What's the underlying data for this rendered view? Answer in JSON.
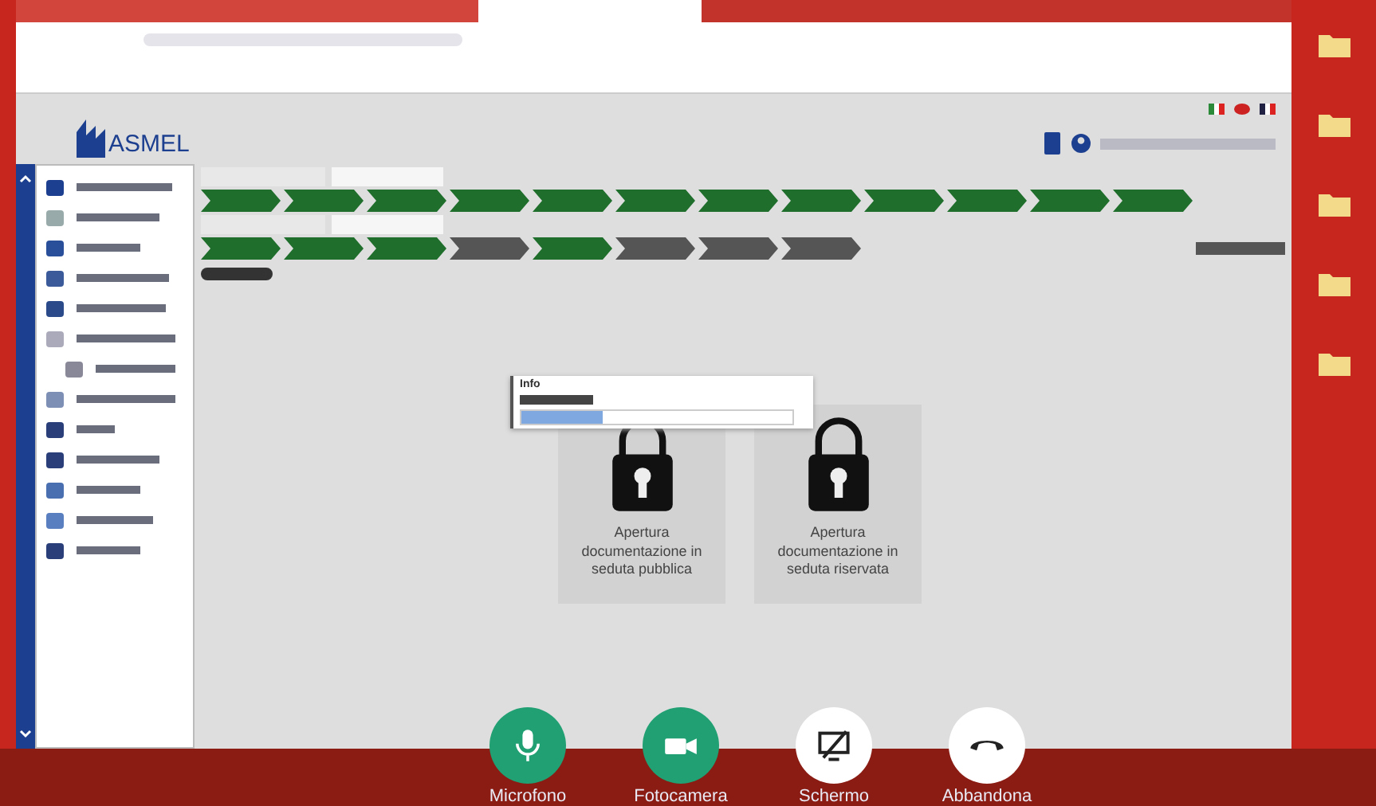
{
  "logo": "ASMEL",
  "breadcrumb_row_1": [
    {
      "color": "#1f6e2c"
    },
    {
      "color": "#1f6e2c"
    },
    {
      "color": "#1f6e2c"
    },
    {
      "color": "#1f6e2c"
    },
    {
      "color": "#1f6e2c"
    },
    {
      "color": "#1f6e2c"
    },
    {
      "color": "#1f6e2c"
    },
    {
      "color": "#1f6e2c"
    },
    {
      "color": "#1f6e2c"
    },
    {
      "color": "#1f6e2c"
    },
    {
      "color": "#1f6e2c"
    },
    {
      "color": "#1f6e2c"
    }
  ],
  "breadcrumb_row_2": [
    {
      "color": "#1f6e2c"
    },
    {
      "color": "#1f6e2c"
    },
    {
      "color": "#1f6e2c"
    },
    {
      "color": "#555555"
    },
    {
      "color": "#1f6e2c"
    },
    {
      "color": "#555555"
    },
    {
      "color": "#555555"
    },
    {
      "color": "#555555"
    }
  ],
  "dropdown": {
    "first_item": "Info"
  },
  "cards": [
    {
      "label": "Apertura documentazione in seduta pubblica"
    },
    {
      "label": "Apertura documentazione in seduta riservata"
    }
  ],
  "call_controls": [
    {
      "kind": "mic",
      "label": "Microfono"
    },
    {
      "kind": "camera",
      "label": "Fotocamera"
    },
    {
      "kind": "screen",
      "label": "Schermo"
    },
    {
      "kind": "hangup",
      "label": "Abbandona"
    }
  ]
}
